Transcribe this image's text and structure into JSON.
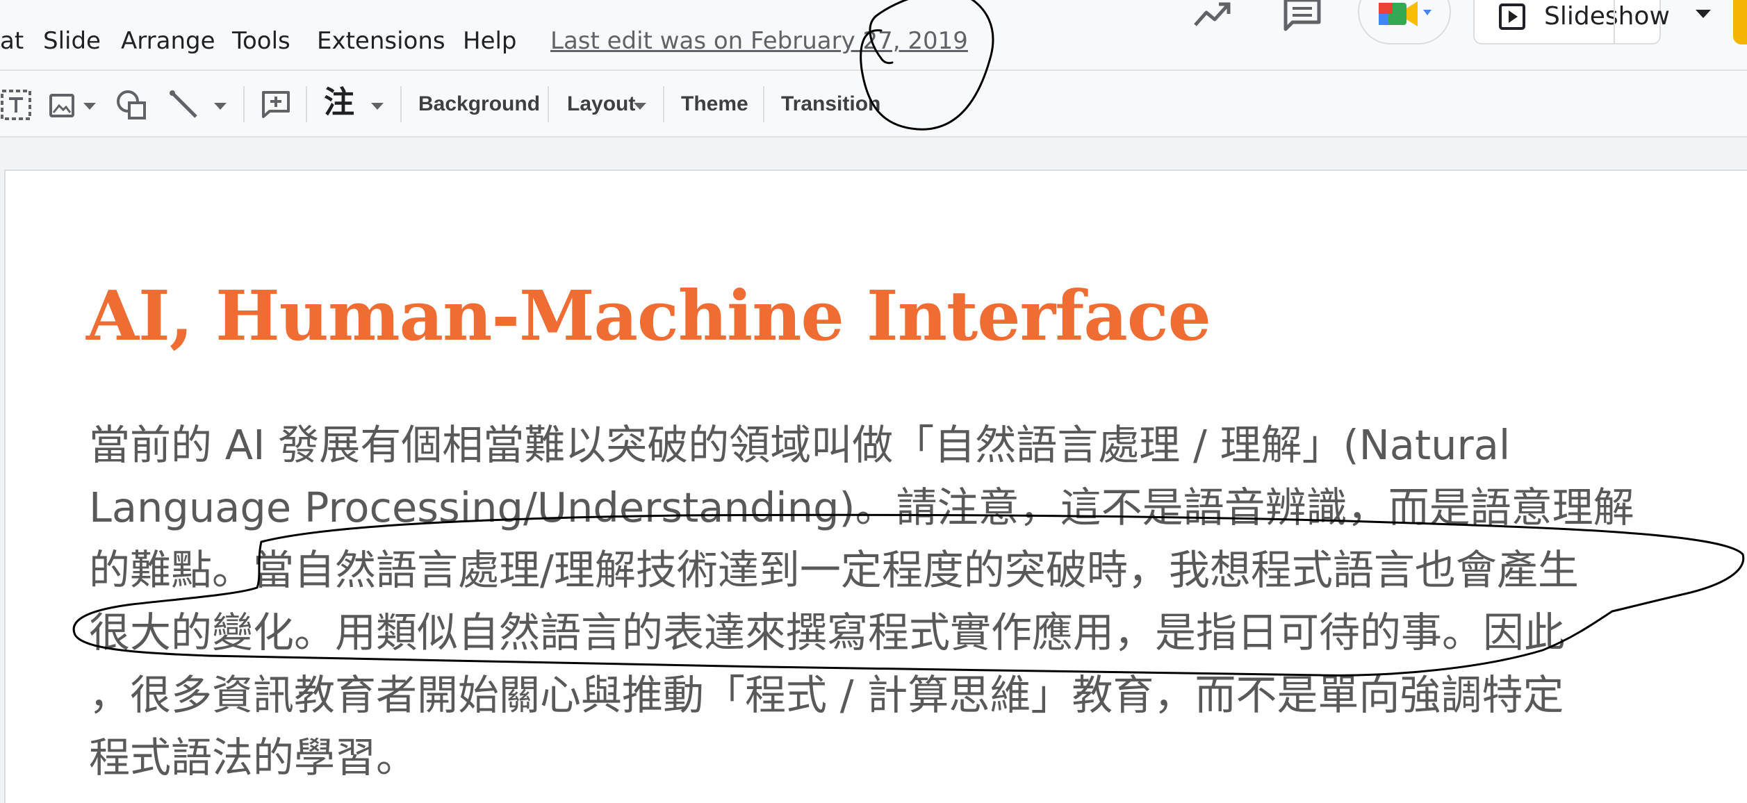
{
  "menu": {
    "items": [
      "at",
      "Slide",
      "Arrange",
      "Tools",
      "Extensions",
      "Help"
    ],
    "last_edit": "Last edit was on February 27, 2019"
  },
  "topbar": {
    "icons": [
      "trending-up-icon",
      "comment-icon",
      "google-meet-icon"
    ],
    "slideshow_label": "Slideshow"
  },
  "toolbar": {
    "icons": [
      "text-box-icon",
      "image-icon",
      "shape-icon",
      "line-icon",
      "new-comment-icon"
    ],
    "input_tools_glyph": "注",
    "background_label": "Background",
    "layout_label": "Layout",
    "theme_label": "Theme",
    "transition_label": "Transition"
  },
  "slide": {
    "title": "AI, Human-Machine Interface",
    "body_lines": [
      "當前的 AI 發展有個相當難以突破的領域叫做「自然語言處理 / 理解」(Natural",
      "Language Processing/Understanding)。請注意，這不是語音辨識，而是語意理解",
      "的難點。當自然語言處理/理解技術達到一定程度的突破時，我想程式語言也會產生",
      "很大的變化。用類似自然語言的表達來撰寫程式實作應用，是指日可待的事。因此",
      "，很多資訊教育者開始關心與推動「程式 / 計算思維」教育，而不是單向強調特定",
      "程式語法的學習。"
    ]
  },
  "colors": {
    "title_orange": "#ef6c33",
    "body_gray": "#595959",
    "ink": "#000000",
    "share_yellow": "#f5b400"
  }
}
